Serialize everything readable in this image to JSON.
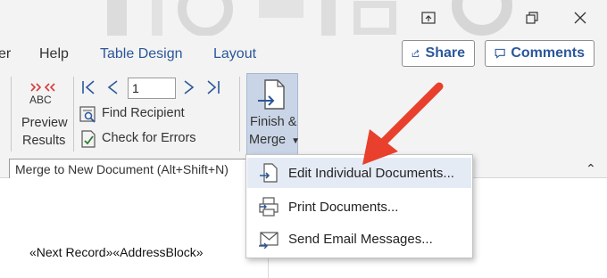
{
  "window": {
    "restore_icon": "restore-icon",
    "close_icon": "close-icon",
    "ribbon_display_icon": "ribbon-display-icon"
  },
  "tabs": {
    "partial": "er",
    "help": "Help",
    "table_design": "Table Design",
    "layout": "Layout"
  },
  "header": {
    "share": "Share",
    "comments": "Comments"
  },
  "ribbon": {
    "abc_glyph": "ABC",
    "preview_line1": "Preview",
    "preview_line2": "Results",
    "record_value": "1",
    "find_recipient": "Find Recipient",
    "check_errors": "Check for Errors",
    "finish_line1": "Finish &",
    "finish_line2": "Merge",
    "tooltip": "Merge to New Document (Alt+Shift+N)"
  },
  "menu": {
    "items": [
      {
        "label": "Edit Individual Documents...",
        "icon": "edit-document-icon"
      },
      {
        "label": "Print Documents...",
        "icon": "print-icon"
      },
      {
        "label": "Send Email Messages...",
        "icon": "email-icon"
      }
    ]
  },
  "document": {
    "merge_fields": "«Next Record»«AddressBlock»"
  },
  "colors": {
    "accent": "#2b579a",
    "arrow": "#e8402c",
    "menu_highlight": "#e5ebf5",
    "finish_pressed": "#c9d5e6"
  }
}
